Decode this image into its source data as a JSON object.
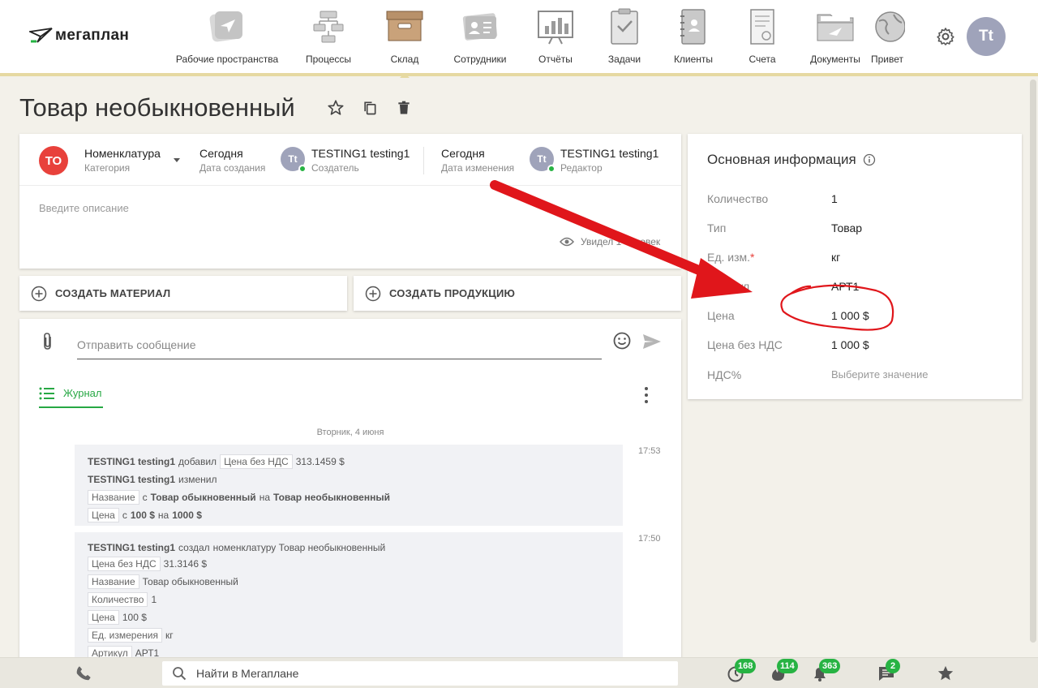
{
  "brand": {
    "logo_text": "мегаплан"
  },
  "nav": [
    {
      "id": "workspaces",
      "label": "Рабочие пространства"
    },
    {
      "id": "processes",
      "label": "Процессы"
    },
    {
      "id": "warehouse",
      "label": "Склад",
      "active": true
    },
    {
      "id": "staff",
      "label": "Сотрудники"
    },
    {
      "id": "reports",
      "label": "Отчёты"
    },
    {
      "id": "tasks",
      "label": "Задачи"
    },
    {
      "id": "clients",
      "label": "Клиенты"
    },
    {
      "id": "invoices",
      "label": "Счета"
    },
    {
      "id": "documents",
      "label": "Документы"
    },
    {
      "id": "greetings",
      "label": "Привет"
    }
  ],
  "user": {
    "initials": "Tt"
  },
  "page": {
    "title": "Товар необыкновенный"
  },
  "item": {
    "badge": "ТО",
    "category_value": "Номенклатура",
    "category_label": "Категория",
    "created_value": "Сегодня",
    "created_label": "Дата создания",
    "creator_initials": "Tt",
    "creator_name": "TESTING1 testing1",
    "creator_label": "Создатель",
    "modified_value": "Сегодня",
    "modified_label": "Дата изменения",
    "editor_initials": "Tt",
    "editor_name": "TESTING1 testing1",
    "editor_label": "Редактор",
    "description_placeholder": "Введите описание",
    "seen_text": "Увидел 1 человек"
  },
  "actions": {
    "create_material": "СОЗДАТЬ МАТЕРИАЛ",
    "create_product": "СОЗДАТЬ ПРОДУКЦИЮ"
  },
  "chat": {
    "placeholder": "Отправить сообщение",
    "journal_tab": "Журнал",
    "date": "Вторник, 4 июня",
    "log1": {
      "time": "17:53",
      "user": "TESTING1 testing1",
      "added": "добавил",
      "field1": "Цена без НДС",
      "value1": "313.1459 $",
      "changed": "изменил",
      "field2": "Название",
      "from": "с",
      "old2": "Товар обыкновенный",
      "to": "на",
      "new2": "Товар необыкновенный",
      "field3": "Цена",
      "from3": "с",
      "old3": "100 $",
      "to3": "на",
      "new3": "1000 $"
    },
    "log2": {
      "time": "17:50",
      "user": "TESTING1 testing1",
      "created": "создал",
      "created_text": "номенклатуру Товар необыкновенный",
      "rows": [
        {
          "k": "Цена без НДС",
          "v": "31.3146 $"
        },
        {
          "k": "Название",
          "v": "Товар обыкновенный"
        },
        {
          "k": "Количество",
          "v": "1"
        },
        {
          "k": "Цена",
          "v": "100 $"
        },
        {
          "k": "Ед. измерения",
          "v": "кг"
        },
        {
          "k": "Артикул",
          "v": "АРТ1"
        }
      ]
    }
  },
  "info": {
    "title": "Основная информация",
    "rows": [
      {
        "k": "Количество",
        "v": "1"
      },
      {
        "k": "Тип",
        "v": "Товар"
      },
      {
        "k": "Ед. изм.",
        "req": "*",
        "v": "кг"
      },
      {
        "k": "Артикул",
        "v": "АРТ1"
      },
      {
        "k": "Цена",
        "v": "1 000 $"
      },
      {
        "k": "Цена без НДС",
        "v": "1 000 $"
      },
      {
        "k": "НДС%",
        "v": "Выберите значение"
      }
    ]
  },
  "bottom": {
    "search_placeholder": "Найти в Мегаплане",
    "badges": {
      "timer": "168",
      "hot": "114",
      "notifications": "363",
      "messages": "2"
    }
  },
  "colors": {
    "accent_green": "#27b343",
    "badge_red": "#e8413b",
    "nav_underline": "#e6d9a1",
    "annotation_red": "#e0161b"
  }
}
